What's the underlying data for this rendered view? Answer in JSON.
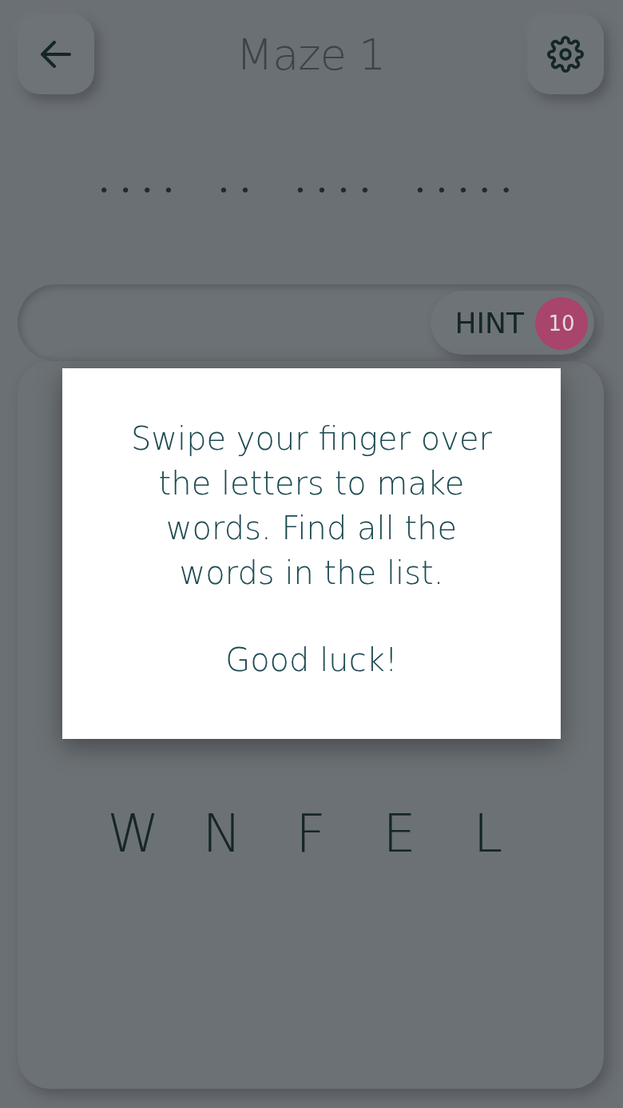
{
  "header": {
    "title": "Maze 1"
  },
  "word_slots": [
    "••••",
    "••",
    "••••",
    "•••••"
  ],
  "hint": {
    "label": "HINT",
    "count": "10"
  },
  "grid_rows": [
    [
      "W",
      "N",
      "F",
      "E",
      "L"
    ]
  ],
  "dialog": {
    "message": "Swipe your finger over the letters to make words. Find all the words in the list.",
    "closing": "Good luck!"
  }
}
